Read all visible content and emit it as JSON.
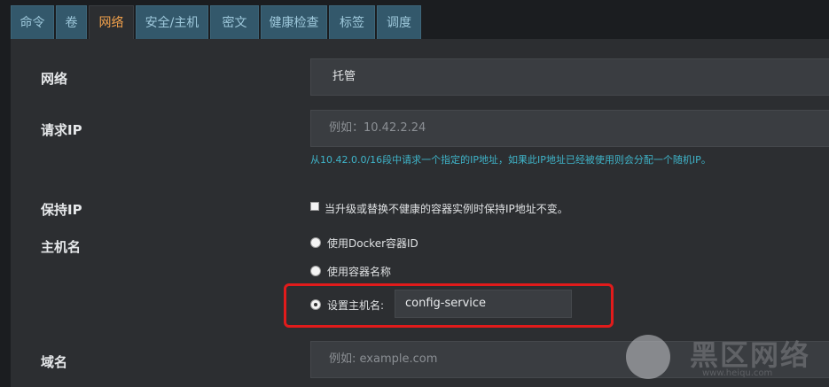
{
  "tabs": [
    {
      "label": "命令"
    },
    {
      "label": "卷"
    },
    {
      "label": "网络"
    },
    {
      "label": "安全/主机"
    },
    {
      "label": "密文"
    },
    {
      "label": "健康检查"
    },
    {
      "label": "标签"
    },
    {
      "label": "调度"
    }
  ],
  "active_tab": "网络",
  "form": {
    "network": {
      "label": "网络",
      "value": "托管"
    },
    "request_ip": {
      "label": "请求IP",
      "placeholder": "例如：10.42.2.24",
      "help": "从10.42.0.0/16段中请求一个指定的IP地址，如果此IP地址已经被使用则会分配一个随机IP。"
    },
    "retain_ip": {
      "label": "保持IP",
      "checkbox_label": "当升级或替换不健康的容器实例时保持IP地址不变。",
      "checked": false
    },
    "hostname": {
      "label": "主机名",
      "options": [
        {
          "label": "使用Docker容器ID",
          "checked": false
        },
        {
          "label": "使用容器名称",
          "checked": false
        },
        {
          "label": "设置主机名:",
          "checked": true
        }
      ],
      "value": "config-service"
    },
    "domain": {
      "label": "域名",
      "placeholder": "例如: example.com"
    }
  },
  "watermark": {
    "text": "黑区网络",
    "sub": "www.heiqu.com"
  },
  "colors": {
    "accent": "#f0a04b",
    "help": "#3fb4c9",
    "tab_bg": "#33586b",
    "highlight": "#e11b1b"
  }
}
